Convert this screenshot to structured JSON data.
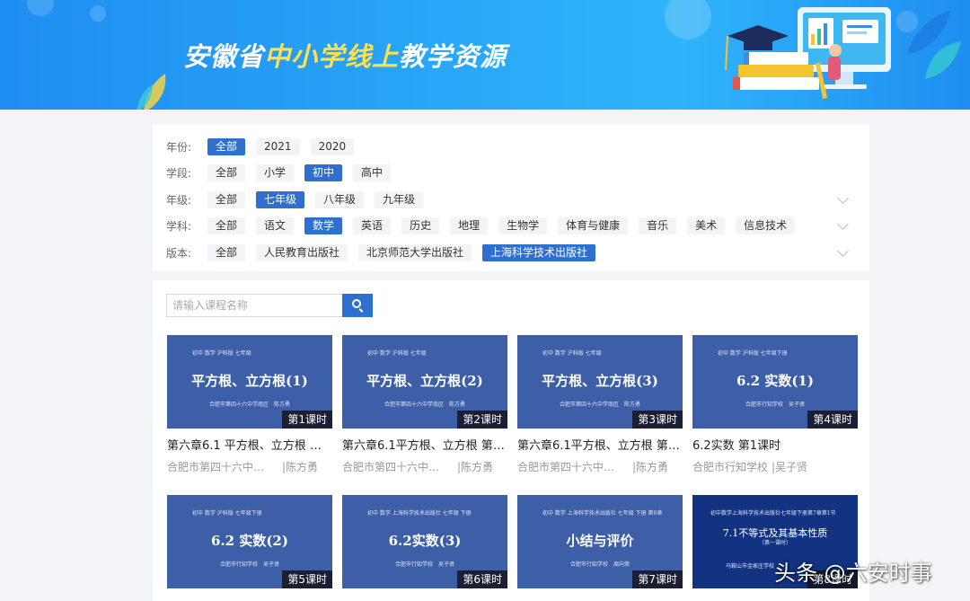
{
  "banner": {
    "title_prefix": "安徽省",
    "title_highlight": "中小学线上",
    "title_suffix": "教学资源"
  },
  "filters": [
    {
      "label": "年份:",
      "options": [
        "全部",
        "2021",
        "2020"
      ],
      "selected": 0,
      "expandable": false
    },
    {
      "label": "学段:",
      "options": [
        "全部",
        "小学",
        "初中",
        "高中"
      ],
      "selected": 2,
      "expandable": false
    },
    {
      "label": "年级:",
      "options": [
        "全部",
        "七年级",
        "八年级",
        "九年级"
      ],
      "selected": 1,
      "expandable": true
    },
    {
      "label": "学科:",
      "options": [
        "全部",
        "语文",
        "数学",
        "英语",
        "历史",
        "地理",
        "生物学",
        "体育与健康",
        "音乐",
        "美术",
        "信息技术"
      ],
      "selected": 2,
      "expandable": true
    },
    {
      "label": "版本:",
      "options": [
        "全部",
        "人民教育出版社",
        "北京师范大学出版社",
        "上海科学技术出版社"
      ],
      "selected": 3,
      "expandable": true
    }
  ],
  "search": {
    "placeholder": "请输入课程名称",
    "value": ""
  },
  "courses": [
    {
      "thumb_header": "初中 数学 沪科版 七年级",
      "thumb_title": "平方根、立方根(1)",
      "thumb_author": "合肥市第四十六中学南区　陈方勇",
      "lesson_badge": "第1课时",
      "title": "第六章6.1 平方根、立方根 第...",
      "school": "合肥市第四十六中学南...",
      "teacher": "|陈方勇"
    },
    {
      "thumb_header": "初中 数学 沪科版 七年级",
      "thumb_title": "平方根、立方根(2)",
      "thumb_author": "合肥市第四十六中学南区　陈方勇",
      "lesson_badge": "第2课时",
      "title": "第六章6.1平方根、立方根 第2...",
      "school": "合肥市第四十六中学南...",
      "teacher": "|陈方勇"
    },
    {
      "thumb_header": "初中 数学 沪科版 七年级",
      "thumb_title": "平方根、立方根(3)",
      "thumb_author": "合肥市第四十六中学南区　陈方勇",
      "lesson_badge": "第3课时",
      "title": "第六章6.1平方根、立方根 第3...",
      "school": "合肥市第四十六中学南...",
      "teacher": "|陈方勇"
    },
    {
      "thumb_header": "初中 数学 沪科版 七年级下册",
      "thumb_title": "6.2 实数(1)",
      "thumb_author": "合肥市行知学校　吴子贤",
      "lesson_badge": "第4课时",
      "title": "6.2实数 第1课时",
      "school": "合肥市行知学校",
      "teacher": "|吴子贤"
    },
    {
      "thumb_header": "初中 数学 沪科版 七年级下册",
      "thumb_title": "6.2 实数(2)",
      "thumb_author": "合肥市行知学校　吴子贤",
      "lesson_badge": "第5课时",
      "title": "",
      "school": "",
      "teacher": ""
    },
    {
      "thumb_header": "初中 数学 上海科学技术出版社 七年级 下册",
      "thumb_title": "6.2实数(3)",
      "thumb_author": "合肥市行知学校　吴子贤",
      "lesson_badge": "第6课时",
      "title": "",
      "school": "",
      "teacher": ""
    },
    {
      "thumb_header": "初中 数学 上海科学技术出版社 七年级 下册 第6章",
      "thumb_title": "小结与评价",
      "thumb_author": "合肥市行知学校　周向荣",
      "lesson_badge": "第7课时",
      "title": "",
      "school": "",
      "teacher": ""
    },
    {
      "thumb_header": "初中数学上海科学技术出版社七年级下册第7章第1节",
      "thumb_title": "7.1不等式及其基本性质",
      "thumb_subtitle": "（第一课时）",
      "thumb_author": "马鞍山市金家庄学校",
      "lesson_badge": "第8课时",
      "title": "",
      "school": "",
      "teacher": "",
      "dark": true
    }
  ],
  "watermark": "头条 @六安时事",
  "colors": {
    "accent": "#2e6fcf",
    "banner_blue": "#29a6f7",
    "thumb_blue": "#3d5fa8",
    "thumb_dark": "#123282",
    "highlight_yellow": "#ffe14a"
  }
}
